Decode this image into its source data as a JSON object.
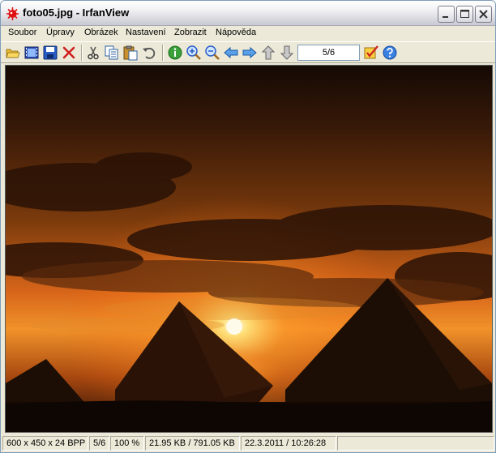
{
  "window": {
    "title": "foto05.jpg - IrfanView"
  },
  "menu": [
    {
      "label": "Soubor"
    },
    {
      "label": "Úpravy"
    },
    {
      "label": "Obrázek"
    },
    {
      "label": "Nastavení"
    },
    {
      "label": "Zobrazit"
    },
    {
      "label": "Nápověda"
    }
  ],
  "toolbar": {
    "page_indicator": "5/6",
    "icons": [
      "open-folder-icon",
      "slideshow-icon",
      "save-icon",
      "delete-icon",
      "cut-icon",
      "copy-icon",
      "paste-icon",
      "undo-icon",
      "info-icon",
      "zoom-in-icon",
      "zoom-out-icon",
      "previous-icon",
      "next-icon",
      "first-icon",
      "last-icon",
      "properties-icon",
      "help-icon"
    ]
  },
  "image": {
    "file": "foto05.jpg",
    "subject": "pyramids-at-sunset"
  },
  "status": {
    "dimensions": "600 x 450 x 24 BPP",
    "index": "5/6",
    "zoom": "100 %",
    "size": "21.95 KB / 791.05 KB",
    "datetime": "22.3.2011 / 10:26:28"
  },
  "colors": {
    "sky_top": "#1a0d06",
    "sun_glow": "#ffd060",
    "pyramid": "#1c0e05",
    "accent": "#ff8c1a"
  }
}
